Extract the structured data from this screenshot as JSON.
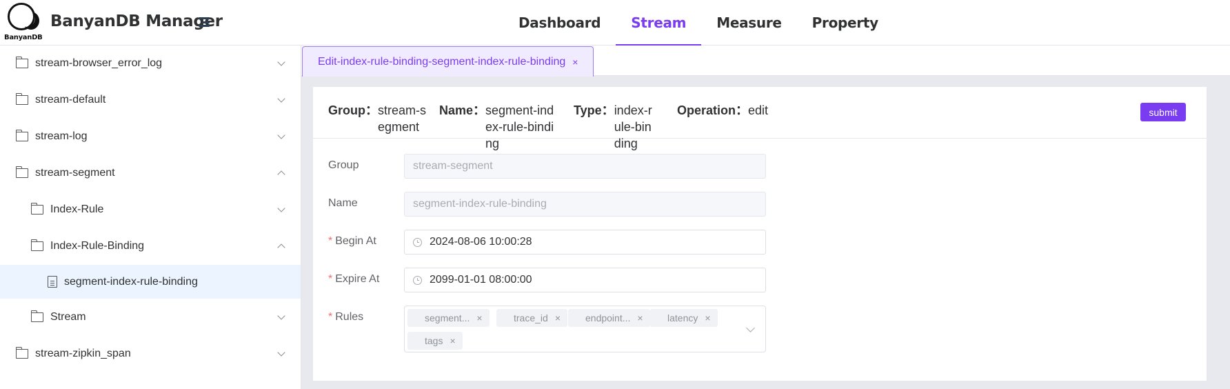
{
  "header": {
    "logo_text": "BanyanDB",
    "app_title": "BanyanDB Manager",
    "nav": [
      {
        "label": "Dashboard",
        "active": false
      },
      {
        "label": "Stream",
        "active": true
      },
      {
        "label": "Measure",
        "active": false
      },
      {
        "label": "Property",
        "active": false
      }
    ]
  },
  "sidebar": {
    "items": [
      {
        "label": "stream-browser_error_log",
        "icon": "folder-icon",
        "expanded": false
      },
      {
        "label": "stream-default",
        "icon": "folder-icon",
        "expanded": false
      },
      {
        "label": "stream-log",
        "icon": "folder-icon",
        "expanded": false
      },
      {
        "label": "stream-segment",
        "icon": "folder-icon",
        "expanded": true
      },
      {
        "label": "Index-Rule",
        "icon": "folder-icon",
        "expanded": false
      },
      {
        "label": "Index-Rule-Binding",
        "icon": "folder-icon",
        "expanded": true
      },
      {
        "label": "segment-index-rule-binding",
        "icon": "document-icon",
        "selected": true
      },
      {
        "label": "Stream",
        "icon": "folder-icon",
        "expanded": false
      },
      {
        "label": "stream-zipkin_span",
        "icon": "folder-icon",
        "expanded": false
      }
    ]
  },
  "tabs": [
    {
      "label": "Edit-index-rule-binding-segment-index-rule-binding",
      "close": "×",
      "active": true
    }
  ],
  "summary": {
    "group_label": "Group：",
    "group_value": "stream-segment",
    "name_label": "Name：",
    "name_value": "segment-index-rule-binding",
    "type_label": "Type：",
    "type_value": "index-rule-binding",
    "operation_label": "Operation：",
    "operation_value": "edit",
    "submit_label": "submit"
  },
  "form": {
    "group": {
      "label": "Group",
      "value": "stream-segment",
      "disabled": true
    },
    "name": {
      "label": "Name",
      "value": "segment-index-rule-binding",
      "disabled": true
    },
    "begin_at": {
      "label": "Begin At",
      "required": true,
      "value": "2024-08-06 10:00:28"
    },
    "expire_at": {
      "label": "Expire At",
      "required": true,
      "value": "2099-01-01 08:00:00"
    },
    "rules": {
      "label": "Rules",
      "required": true,
      "tags": [
        "segment...",
        "trace_id",
        "endpoint...",
        "latency",
        "tags"
      ]
    },
    "required_mark": "*",
    "tag_close": "×"
  },
  "colors": {
    "accent": "#7a3cf0",
    "selected_bg": "#ecf4ff",
    "required": "#f56c6c"
  }
}
